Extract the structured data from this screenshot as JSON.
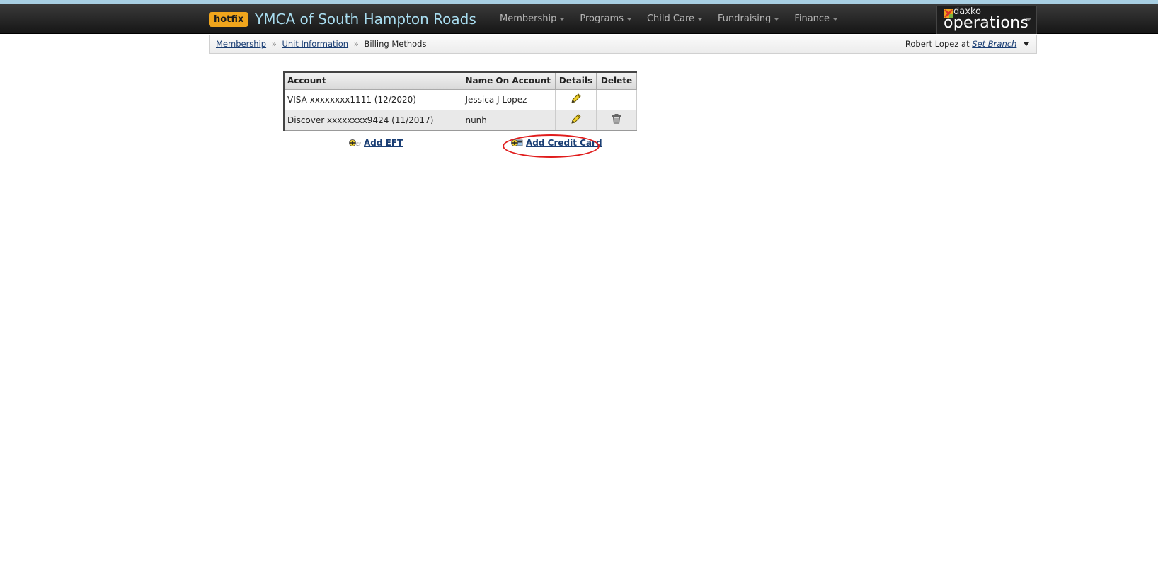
{
  "header": {
    "badge": "hotfix",
    "org_title": "YMCA of South Hampton Roads",
    "menu": [
      {
        "label": "Membership"
      },
      {
        "label": "Programs"
      },
      {
        "label": "Child Care"
      },
      {
        "label": "Fundraising"
      },
      {
        "label": "Finance"
      }
    ],
    "brand_small": "daxko",
    "brand_big": "operations"
  },
  "breadcrumb": {
    "items": [
      "Membership",
      "Unit Information"
    ],
    "current": "Billing Methods",
    "separator": "»"
  },
  "user": {
    "name": "Robert Lopez",
    "at": "at",
    "branch_link": "Set Branch"
  },
  "billing_table": {
    "columns": [
      "Account",
      "Name On Account",
      "Details",
      "Delete"
    ],
    "rows": [
      {
        "account": "VISA xxxxxxxx1111 (12/2020)",
        "name": "Jessica J Lopez",
        "delete_text": "-"
      },
      {
        "account": "Discover xxxxxxxx9424 (11/2017)",
        "name": "nunh",
        "delete_text": ""
      }
    ]
  },
  "actions": {
    "add_eft": "Add EFT",
    "add_credit_card": "Add Credit Card"
  },
  "colors": {
    "accent_badge": "#f0a51c",
    "title_color": "#a8dcef",
    "link": "#1a3e74",
    "highlight": "#e01c1c"
  }
}
